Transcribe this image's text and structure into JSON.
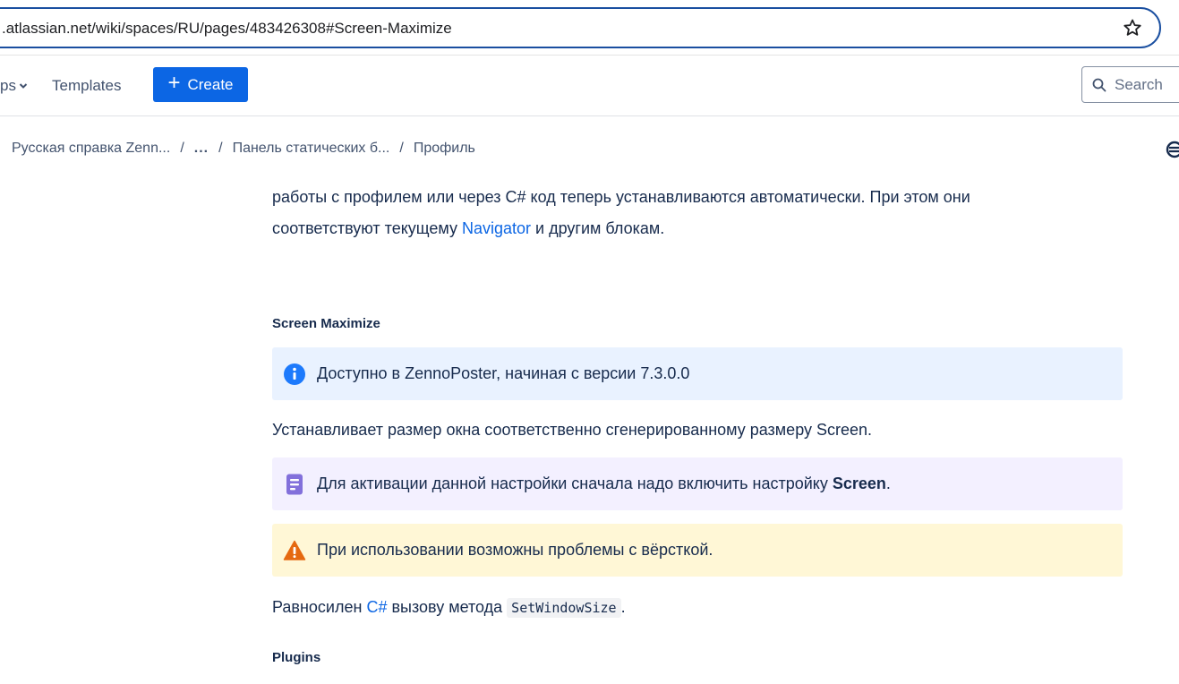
{
  "browser": {
    "url": ".atlassian.net/wiki/spaces/RU/pages/483426308#Screen-Maximize"
  },
  "topnav": {
    "apps_label": "ps",
    "templates_label": "Templates",
    "create_label": "Create",
    "search_placeholder": "Search"
  },
  "breadcrumb": {
    "items": [
      "Русская справка Zenn...",
      "...",
      "Панель статических б...",
      "Профиль"
    ],
    "separator": "/"
  },
  "content": {
    "intro_line1": "работы с профилем или через C# код теперь устанавливаются автоматически. При этом они",
    "intro_line2_before": "соответствуют текущему ",
    "intro_link": "Navigator",
    "intro_line2_after": " и другим блокам.",
    "section_title": "Screen Maximize",
    "info_panel": "Доступно в ZennoPoster, начиная с версии 7.3.0.0",
    "description": "Устанавливает размер окна соответственно сгенерированному размеру Screen.",
    "note_before": "Для активации данной настройки сначала надо включить настройку ",
    "note_bold": "Screen",
    "note_after": ".",
    "warning_panel": "При использовании возможны проблемы с вёрсткой.",
    "equiv_before": "Равносилен ",
    "equiv_link": "C#",
    "equiv_middle": " вызову метода ",
    "equiv_code": "SetWindowSize",
    "equiv_after": ".",
    "next_section_title": "Plugins"
  },
  "colors": {
    "primary": "#0c66e4",
    "info_bg": "#e9f2ff",
    "note_bg": "#f3f0ff",
    "warn_bg": "#fff7d6",
    "info_icon": "#1d7afc",
    "note_icon": "#8270db",
    "warn_icon": "#e56910"
  }
}
